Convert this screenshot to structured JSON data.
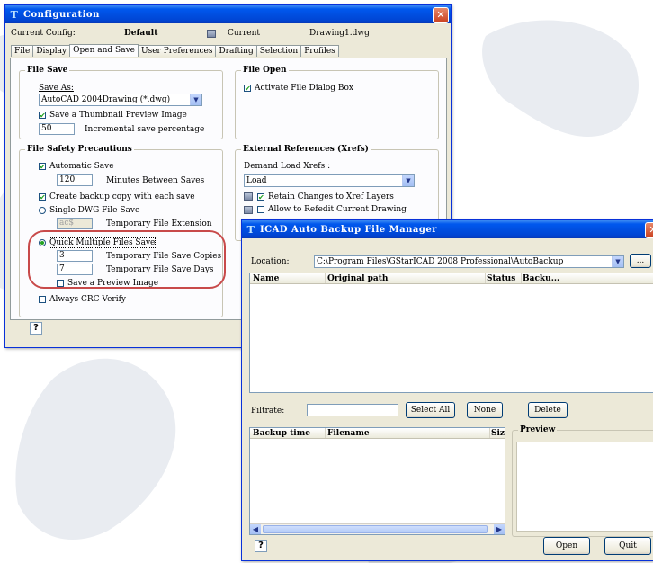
{
  "colors": {
    "title_bar": "#0050e6",
    "highlight_ring": "#c84a4a",
    "window_bg": "#ece9d8"
  },
  "config": {
    "title": "Configuration",
    "current_config_label": "Current Config:",
    "current_config_value": "Default",
    "current_drawing_label": "Current",
    "current_drawing_value": "Drawing1.dwg",
    "tabs": [
      "File",
      "Display",
      "Open and Save",
      "User Preferences",
      "Drafting",
      "Selection",
      "Profiles"
    ],
    "active_tab": "Open and Save",
    "file_save": {
      "title": "File Save",
      "save_as_label": "Save As:",
      "save_as_value": "AutoCAD 2004Drawing (*.dwg)",
      "thumbnail_label": "Save a Thumbnail Preview Image",
      "thumbnail_checked": true,
      "incremental_value": "50",
      "incremental_label": "Incremental save percentage"
    },
    "file_open": {
      "title": "File Open",
      "activate_label": "Activate File Dialog Box",
      "activate_checked": true
    },
    "safety": {
      "title": "File Safety Precautions",
      "autosave_label": "Automatic Save",
      "autosave_checked": true,
      "minutes_value": "120",
      "minutes_label": "Minutes Between Saves",
      "backup_label": "Create backup copy with each save",
      "backup_checked": true,
      "single_label": "Single DWG File Save",
      "temp_ext_value": "ac$",
      "temp_ext_label": "Temporary File Extension",
      "quick_label": "Quick Multiple Files Save",
      "copies_value": "3",
      "copies_label": "Temporary File Save Copies",
      "days_value": "7",
      "days_label": "Temporary File Save Days",
      "preview_label": "Save a Preview Image",
      "crc_label": "Always CRC Verify"
    },
    "xref": {
      "title": "External References (Xrefs)",
      "demand_label": "Demand Load Xrefs :",
      "demand_value": "Load",
      "retain_label": "Retain Changes to Xref Layers",
      "retain_checked": true,
      "refedit_label": "Allow to Refedit Current Drawing"
    },
    "help_label": "?"
  },
  "backup": {
    "title": "ICAD Auto Backup File Manager",
    "location_label": "Location:",
    "location_value": "C:\\Program Files\\GStarICAD 2008 Professional\\AutoBackup",
    "browse_label": "...",
    "table_columns": [
      "Name",
      "Original path",
      "Status",
      "Backu..."
    ],
    "filtrate_label": "Filtrate:",
    "filtrate_value": "",
    "select_all_label": "Select All",
    "none_label": "None",
    "delete_label": "Delete",
    "lower_columns": [
      "Backup time",
      "Filename",
      "Siz"
    ],
    "preview_label": "Preview",
    "help_label": "?",
    "open_label": "Open",
    "quit_label": "Quit"
  }
}
